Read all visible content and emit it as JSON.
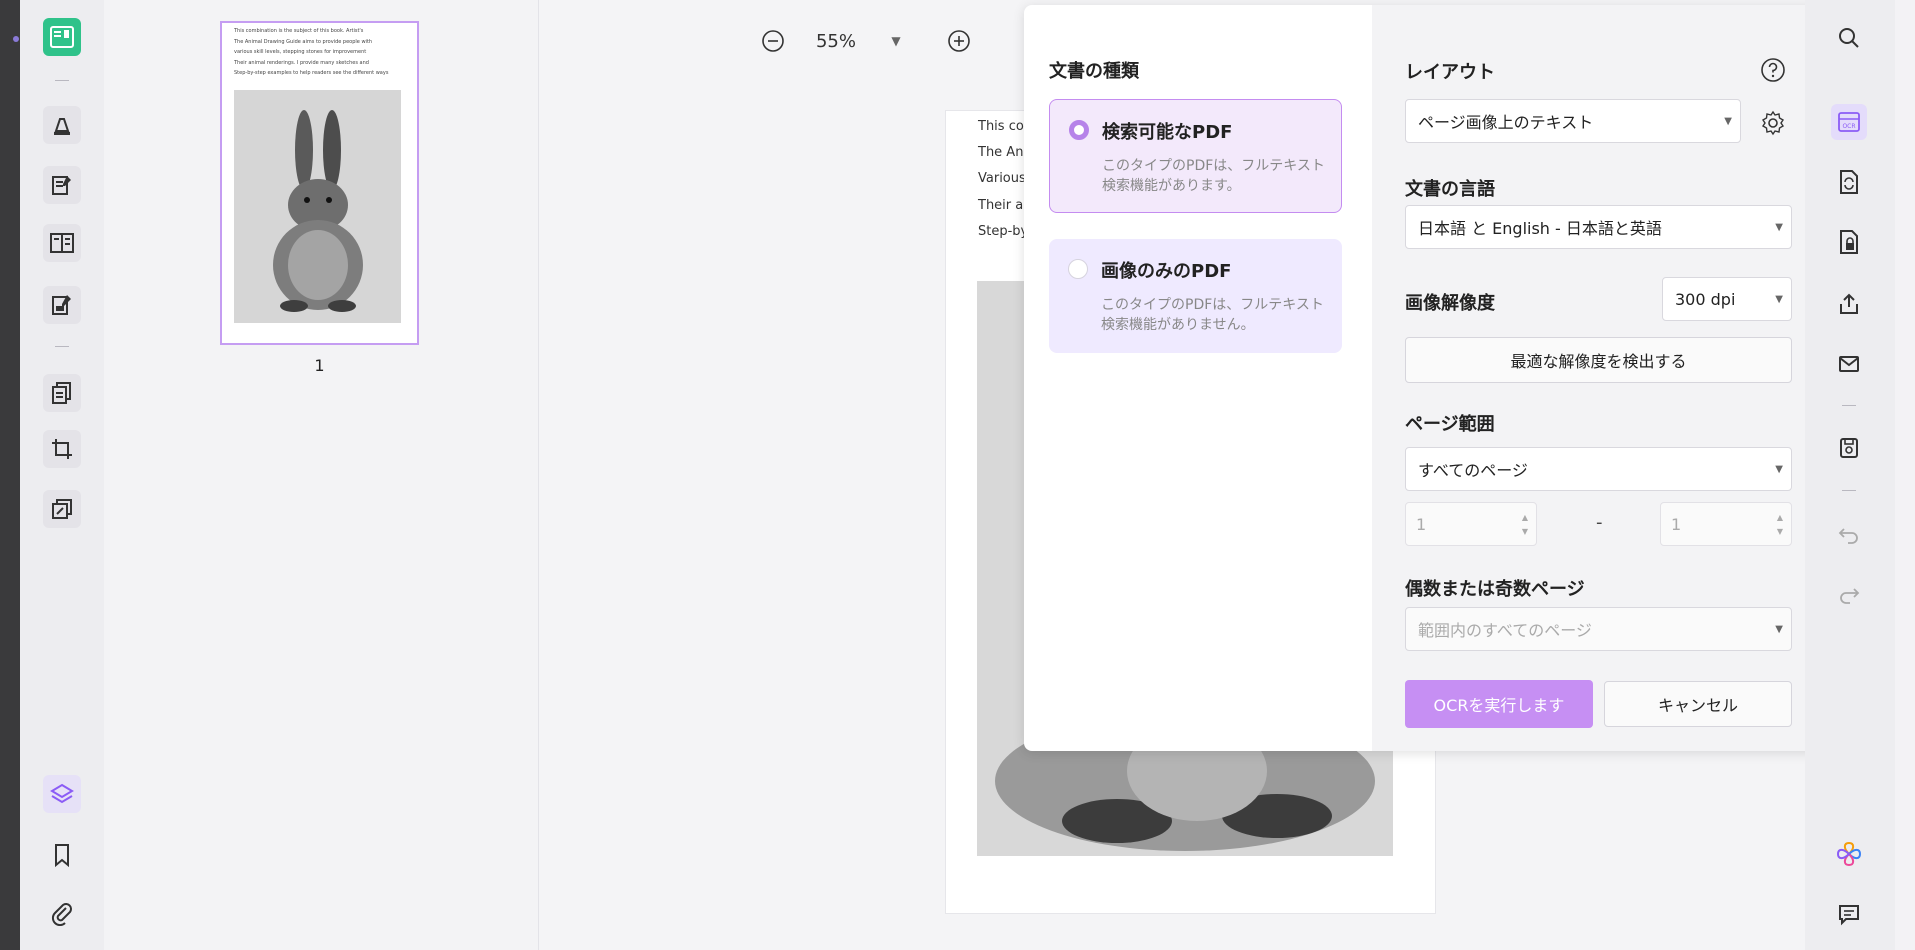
{
  "zoom": {
    "value": "55%"
  },
  "thumbnail": {
    "page_number": "1",
    "lines": [
      "This combination is the subject of this book. Artist's",
      "The Animal Drawing Guide aims to provide people with",
      "various skill levels, stepping stones for improvement",
      "Their animal renderings. I provide many sketches and",
      "Step-by-step examples to help readers see the different ways"
    ]
  },
  "page": {
    "lines": [
      "This co",
      "The Ani",
      "Various",
      "Their an",
      "Step-by"
    ]
  },
  "ocr": {
    "doc_type_title": "文書の種類",
    "options": [
      {
        "title": "検索可能なPDF",
        "desc": "このタイプのPDFは、フルテキスト検索機能があります。",
        "selected": true
      },
      {
        "title": "画像のみのPDF",
        "desc": "このタイプのPDFは、フルテキスト検索機能がありません。",
        "selected": false
      }
    ],
    "layout_label": "レイアウト",
    "layout_value": "ページ画像上のテキスト",
    "language_label": "文書の言語",
    "language_value": "日本語 と English - 日本語と英語",
    "resolution_label": "画像解像度",
    "resolution_value": "300 dpi",
    "detect_button": "最適な解像度を検出する",
    "page_range_label": "ページ範囲",
    "page_range_value": "すべてのページ",
    "range_from": "1",
    "range_dash": "-",
    "range_to": "1",
    "odd_even_label": "偶数または奇数ページ",
    "odd_even_value": "範囲内のすべてのページ",
    "run_button": "OCRを実行します",
    "cancel_button": "キャンセル"
  },
  "colors": {
    "accent": "#c68ff3",
    "active_tool": "#2fc28a",
    "selected_card_border": "#c48cf0"
  }
}
